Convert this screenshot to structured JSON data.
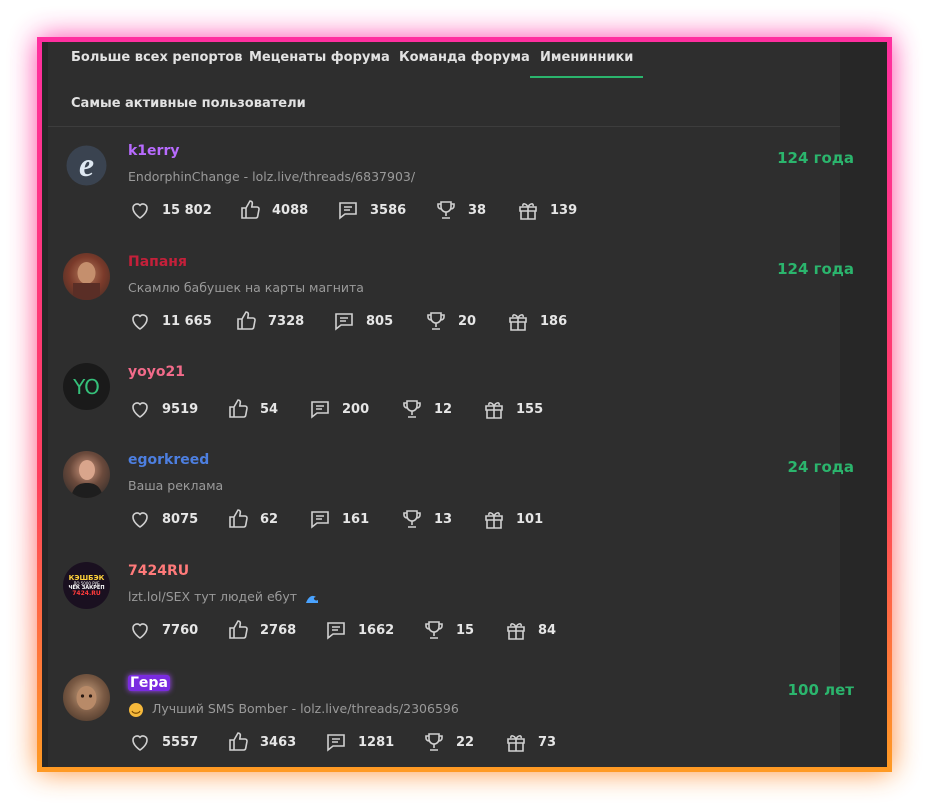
{
  "tabs": [
    {
      "label": "Больше всех репортов",
      "active": false
    },
    {
      "label": "Меценаты форума",
      "active": false
    },
    {
      "label": "Команда форума",
      "active": false
    },
    {
      "label": "Именинники",
      "active": true
    },
    {
      "label": "Самые активные пользователи",
      "active": false
    }
  ],
  "accent_color": "#2bb56d",
  "stat_icons": [
    "heart-icon",
    "thumbs-up-icon",
    "comment-icon",
    "trophy-icon",
    "gift-icon"
  ],
  "members": [
    {
      "username": "k1erry",
      "username_color": "#b86bff",
      "status": "EndorphinChange - lolz.live/threads/6837903/",
      "age": "124 года",
      "stats": [
        "15 802",
        "4088",
        "3586",
        "38",
        "139"
      ]
    },
    {
      "username": "Папаня",
      "username_color": "#c4203a",
      "status": "Скамлю бабушек на карты магнита",
      "age": "124 года",
      "stats": [
        "11 665",
        "7328",
        "805",
        "20",
        "186"
      ]
    },
    {
      "username": "yoyo21",
      "username_color": "#f26b8a",
      "avatar_initials": "YO",
      "status": "",
      "age": "",
      "stats": [
        "9519",
        "54",
        "200",
        "12",
        "155"
      ]
    },
    {
      "username": "egorkreed",
      "username_color": "#4d7fe0",
      "status": "Ваша реклама",
      "age": "24 года",
      "stats": [
        "8075",
        "62",
        "161",
        "13",
        "101"
      ]
    },
    {
      "username": "7424RU",
      "username_color": "#ff7a7a",
      "status": "lzt.lol/SEX тут людей ебут",
      "age": "",
      "avatar_text": [
        "КЭШБЭК",
        "ДО 5000 РУБ",
        "ЧЕК ЗАКРЕП",
        "7424.RU"
      ],
      "stats": [
        "7760",
        "2768",
        "1662",
        "15",
        "84"
      ]
    },
    {
      "username": "Гера",
      "username_color": "#ffffff",
      "status": "Лучший SMS Bomber - lolz.live/threads/2306596",
      "age": "100 лет",
      "stats": [
        "5557",
        "3463",
        "1281",
        "22",
        "73"
      ]
    }
  ]
}
